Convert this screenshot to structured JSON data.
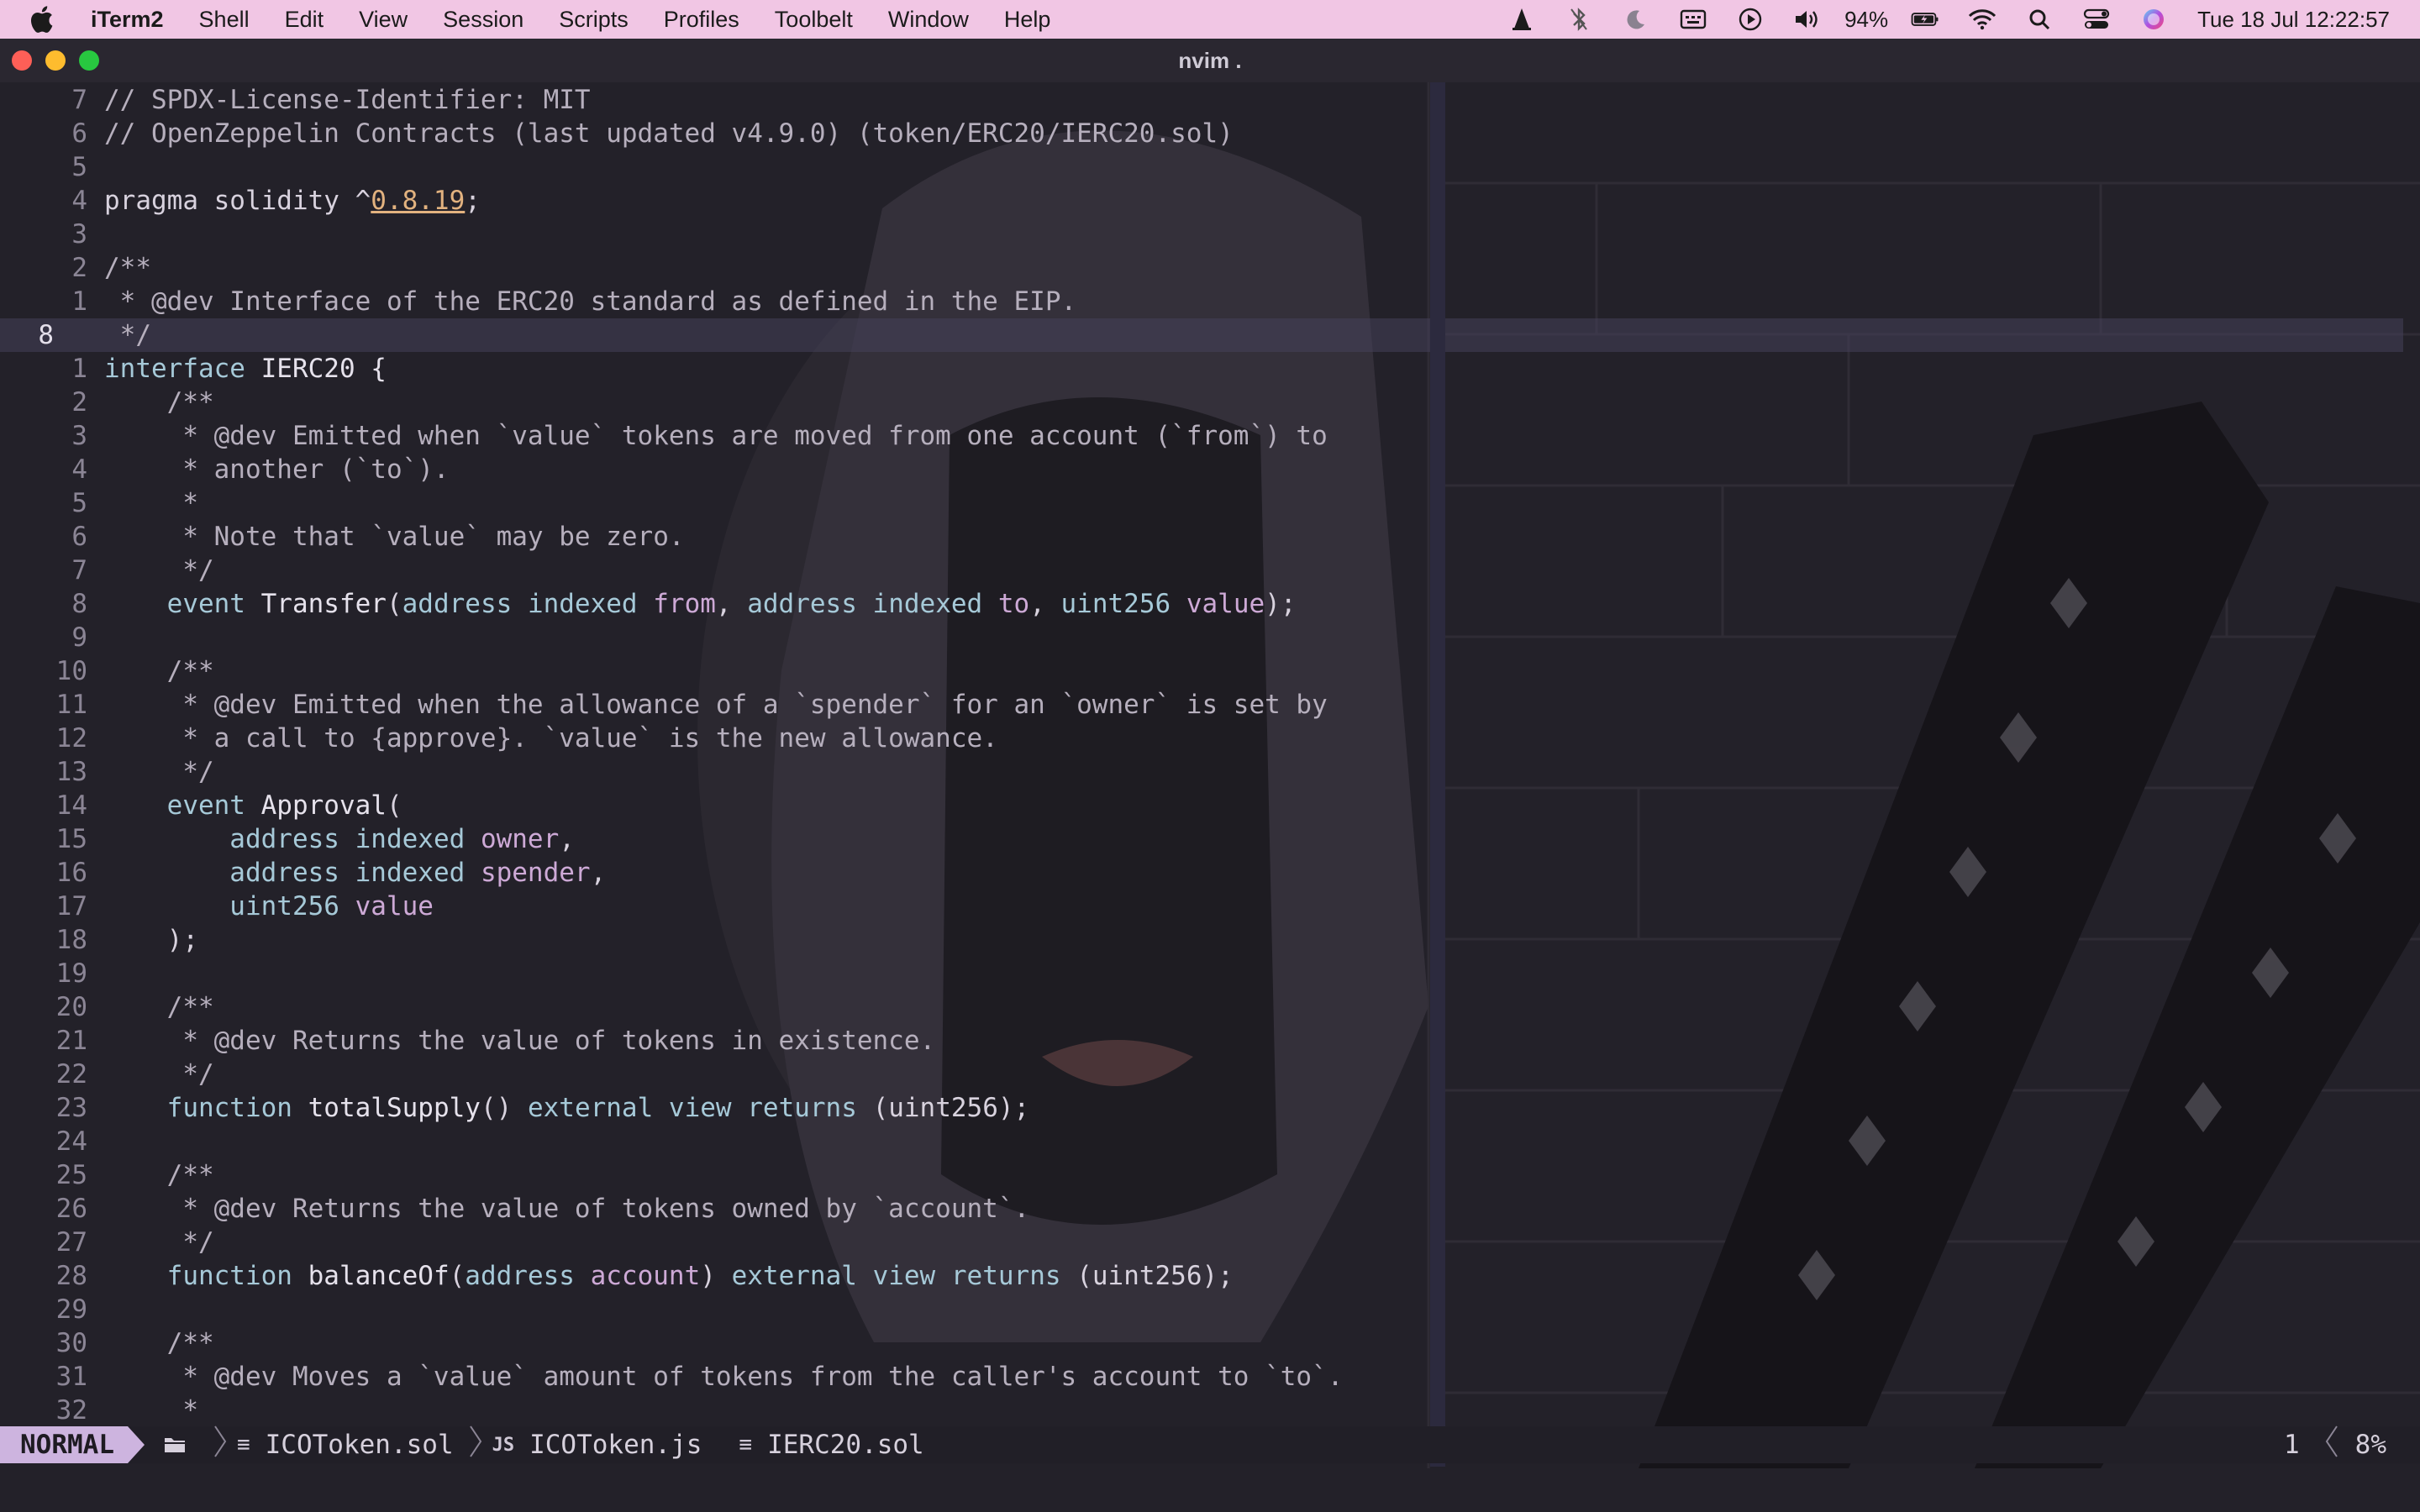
{
  "menubar": {
    "app_name": "iTerm2",
    "items": [
      "Shell",
      "Edit",
      "View",
      "Session",
      "Scripts",
      "Profiles",
      "Toolbelt",
      "Window",
      "Help"
    ],
    "battery": "94%",
    "clock": "Tue 18 Jul  12:22:57",
    "icons": [
      "vlc-icon",
      "bluetooth-icon",
      "moon-icon",
      "keyboard-icon",
      "play-icon",
      "volume-icon",
      "battery-icon",
      "wifi-icon",
      "search-icon",
      "control-center-icon",
      "siri-icon"
    ]
  },
  "window": {
    "title": "nvim ."
  },
  "editor": {
    "lines": [
      {
        "n": "7",
        "tokens": [
          {
            "t": "// SPDX-License-Identifier: MIT",
            "c": "comment"
          }
        ]
      },
      {
        "n": "6",
        "tokens": [
          {
            "t": "// OpenZeppelin Contracts (last updated v4.9.0) (token/ERC20/IERC20.sol)",
            "c": "comment"
          }
        ]
      },
      {
        "n": "5",
        "tokens": []
      },
      {
        "n": "4",
        "tokens": [
          {
            "t": "pragma solidity ^",
            "c": "plain"
          },
          {
            "t": "0.8.19",
            "c": "num"
          },
          {
            "t": ";",
            "c": "plain"
          }
        ]
      },
      {
        "n": "3",
        "tokens": []
      },
      {
        "n": "2",
        "tokens": [
          {
            "t": "/**",
            "c": "comment"
          }
        ]
      },
      {
        "n": "1",
        "tokens": [
          {
            "t": " * @dev Interface of the ERC20 standard as defined in the EIP.",
            "c": "comment"
          }
        ]
      },
      {
        "n": "8",
        "current": true,
        "tokens": [
          {
            "t": " */",
            "c": "comment"
          }
        ]
      },
      {
        "n": "1",
        "tokens": [
          {
            "t": "interface ",
            "c": "kw"
          },
          {
            "t": "IERC20 {",
            "c": "fn"
          }
        ]
      },
      {
        "n": "2",
        "tokens": [
          {
            "t": "    /**",
            "c": "comment"
          }
        ]
      },
      {
        "n": "3",
        "tokens": [
          {
            "t": "     * @dev Emitted when `value` tokens are moved from one account (`from`) to",
            "c": "comment"
          }
        ]
      },
      {
        "n": "4",
        "tokens": [
          {
            "t": "     * another (`to`).",
            "c": "comment"
          }
        ]
      },
      {
        "n": "5",
        "tokens": [
          {
            "t": "     *",
            "c": "comment"
          }
        ]
      },
      {
        "n": "6",
        "tokens": [
          {
            "t": "     * Note that `value` may be zero.",
            "c": "comment"
          }
        ]
      },
      {
        "n": "7",
        "tokens": [
          {
            "t": "     */",
            "c": "comment"
          }
        ]
      },
      {
        "n": "8",
        "tokens": [
          {
            "t": "    event ",
            "c": "kw"
          },
          {
            "t": "Transfer",
            "c": "fn"
          },
          {
            "t": "(",
            "c": "plain"
          },
          {
            "t": "address ",
            "c": "type"
          },
          {
            "t": "indexed ",
            "c": "kw"
          },
          {
            "t": "from",
            "c": "param"
          },
          {
            "t": ", ",
            "c": "plain"
          },
          {
            "t": "address ",
            "c": "type"
          },
          {
            "t": "indexed ",
            "c": "kw"
          },
          {
            "t": "to",
            "c": "param"
          },
          {
            "t": ", ",
            "c": "plain"
          },
          {
            "t": "uint256 ",
            "c": "type"
          },
          {
            "t": "value",
            "c": "param"
          },
          {
            "t": ");",
            "c": "plain"
          }
        ]
      },
      {
        "n": "9",
        "tokens": []
      },
      {
        "n": "10",
        "tokens": [
          {
            "t": "    /**",
            "c": "comment"
          }
        ]
      },
      {
        "n": "11",
        "tokens": [
          {
            "t": "     * @dev Emitted when the allowance of a `spender` for an `owner` is set by",
            "c": "comment"
          }
        ]
      },
      {
        "n": "12",
        "tokens": [
          {
            "t": "     * a call to {approve}. `value` is the new allowance.",
            "c": "comment"
          }
        ]
      },
      {
        "n": "13",
        "tokens": [
          {
            "t": "     */",
            "c": "comment"
          }
        ]
      },
      {
        "n": "14",
        "tokens": [
          {
            "t": "    event ",
            "c": "kw"
          },
          {
            "t": "Approval",
            "c": "fn"
          },
          {
            "t": "(",
            "c": "plain"
          }
        ]
      },
      {
        "n": "15",
        "tokens": [
          {
            "t": "        address ",
            "c": "type"
          },
          {
            "t": "indexed ",
            "c": "kw"
          },
          {
            "t": "owner",
            "c": "param"
          },
          {
            "t": ",",
            "c": "plain"
          }
        ]
      },
      {
        "n": "16",
        "tokens": [
          {
            "t": "        address ",
            "c": "type"
          },
          {
            "t": "indexed ",
            "c": "kw"
          },
          {
            "t": "spender",
            "c": "param"
          },
          {
            "t": ",",
            "c": "plain"
          }
        ]
      },
      {
        "n": "17",
        "tokens": [
          {
            "t": "        uint256 ",
            "c": "type"
          },
          {
            "t": "value",
            "c": "param"
          }
        ]
      },
      {
        "n": "18",
        "tokens": [
          {
            "t": "    );",
            "c": "plain"
          }
        ]
      },
      {
        "n": "19",
        "tokens": []
      },
      {
        "n": "20",
        "tokens": [
          {
            "t": "    /**",
            "c": "comment"
          }
        ]
      },
      {
        "n": "21",
        "tokens": [
          {
            "t": "     * @dev Returns the value of tokens in existence.",
            "c": "comment"
          }
        ]
      },
      {
        "n": "22",
        "tokens": [
          {
            "t": "     */",
            "c": "comment"
          }
        ]
      },
      {
        "n": "23",
        "tokens": [
          {
            "t": "    function ",
            "c": "kw"
          },
          {
            "t": "totalSupply",
            "c": "fn"
          },
          {
            "t": "() ",
            "c": "plain"
          },
          {
            "t": "external view returns ",
            "c": "kw"
          },
          {
            "t": "(uint256);",
            "c": "plain"
          }
        ]
      },
      {
        "n": "24",
        "tokens": []
      },
      {
        "n": "25",
        "tokens": [
          {
            "t": "    /**",
            "c": "comment"
          }
        ]
      },
      {
        "n": "26",
        "tokens": [
          {
            "t": "     * @dev Returns the value of tokens owned by `account`.",
            "c": "comment"
          }
        ]
      },
      {
        "n": "27",
        "tokens": [
          {
            "t": "     */",
            "c": "comment"
          }
        ]
      },
      {
        "n": "28",
        "tokens": [
          {
            "t": "    function ",
            "c": "kw"
          },
          {
            "t": "balanceOf",
            "c": "fn"
          },
          {
            "t": "(",
            "c": "plain"
          },
          {
            "t": "address ",
            "c": "type"
          },
          {
            "t": "account",
            "c": "param"
          },
          {
            "t": ") ",
            "c": "plain"
          },
          {
            "t": "external view returns ",
            "c": "kw"
          },
          {
            "t": "(uint256);",
            "c": "plain"
          }
        ]
      },
      {
        "n": "29",
        "tokens": []
      },
      {
        "n": "30",
        "tokens": [
          {
            "t": "    /**",
            "c": "comment"
          }
        ]
      },
      {
        "n": "31",
        "tokens": [
          {
            "t": "     * @dev Moves a `value` amount of tokens from the caller's account to `to`.",
            "c": "comment"
          }
        ]
      },
      {
        "n": "32",
        "tokens": [
          {
            "t": "     *",
            "c": "comment"
          }
        ]
      }
    ]
  },
  "statusline": {
    "mode": "NORMAL",
    "buffers": [
      {
        "icon": "≡",
        "name": "ICOToken.sol"
      },
      {
        "icon": "JS",
        "name": "ICOToken.js"
      },
      {
        "icon": "≡",
        "name": "IERC20.sol"
      }
    ],
    "line": "1",
    "percent": "8%"
  }
}
